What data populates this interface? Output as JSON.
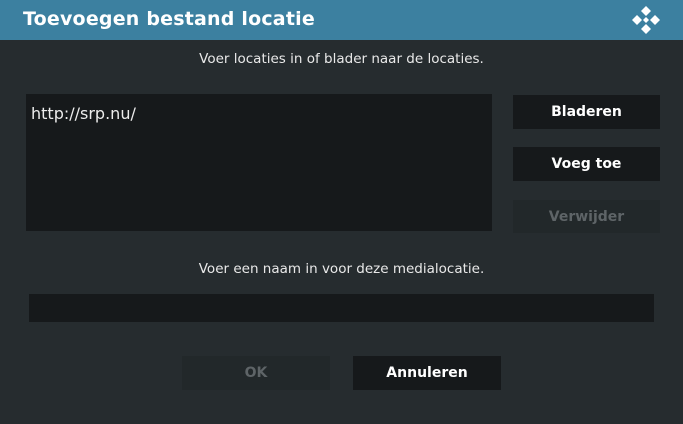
{
  "dialog": {
    "title": "Toevoegen bestand locatie",
    "logo_icon": "kodi-logo-icon"
  },
  "locations": {
    "instruction": "Voer locaties in of blader naar de locaties.",
    "items": [
      "http://srp.nu/"
    ]
  },
  "buttons": {
    "browse": "Bladeren",
    "add": "Voeg toe",
    "remove": "Verwijder",
    "ok": "OK",
    "cancel": "Annuleren"
  },
  "name": {
    "instruction": "Voer een naam in voor deze medialocatie.",
    "value": ""
  },
  "colors": {
    "header": "#3c80a0",
    "background": "#262c2f",
    "field": "#16191b"
  }
}
